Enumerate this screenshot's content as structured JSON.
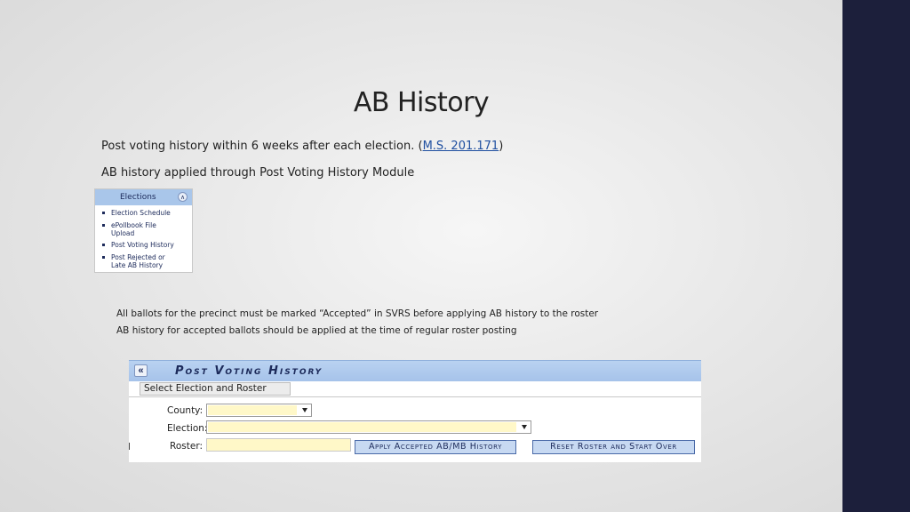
{
  "slide": {
    "title": "AB History",
    "line1_text": "Post voting history within 6 weeks after each election. (",
    "line1_link": "M.S. 201.171",
    "line1_close": ")",
    "line2": "AB history applied through Post Voting History Module",
    "bullet_a": "All ballots for the precinct must be marked “Accepted” in SVRS before applying AB history to the roster",
    "bullet_b": "AB history for accepted ballots should be applied at the time of regular roster posting",
    "sidebar_color": "#1c1f3b"
  },
  "elections_menu": {
    "header": "Elections",
    "collapse_icon": "double-chevron-up-icon",
    "items": [
      {
        "line1": "Election Schedule",
        "line2": ""
      },
      {
        "line1": "ePollbook File",
        "line2": "Upload"
      },
      {
        "line1": "Post Voting History",
        "line2": ""
      },
      {
        "line1": "Post Rejected or",
        "line2": "Late AB History"
      }
    ]
  },
  "post_voting_history": {
    "back_icon": "double-chevron-left-icon",
    "title": "Post Voting History",
    "tab_label": "Select Election and Roster",
    "county_label": "County:",
    "election_label": "Election:",
    "roster_label": "Roster:",
    "county_value": "",
    "election_value": "",
    "roster_value": "",
    "apply_button": "Apply Accepted AB/MB History",
    "reset_button": "Reset Roster and Start Over",
    "field_color": "#fff8c8",
    "header_color": "#a9c6ea"
  }
}
